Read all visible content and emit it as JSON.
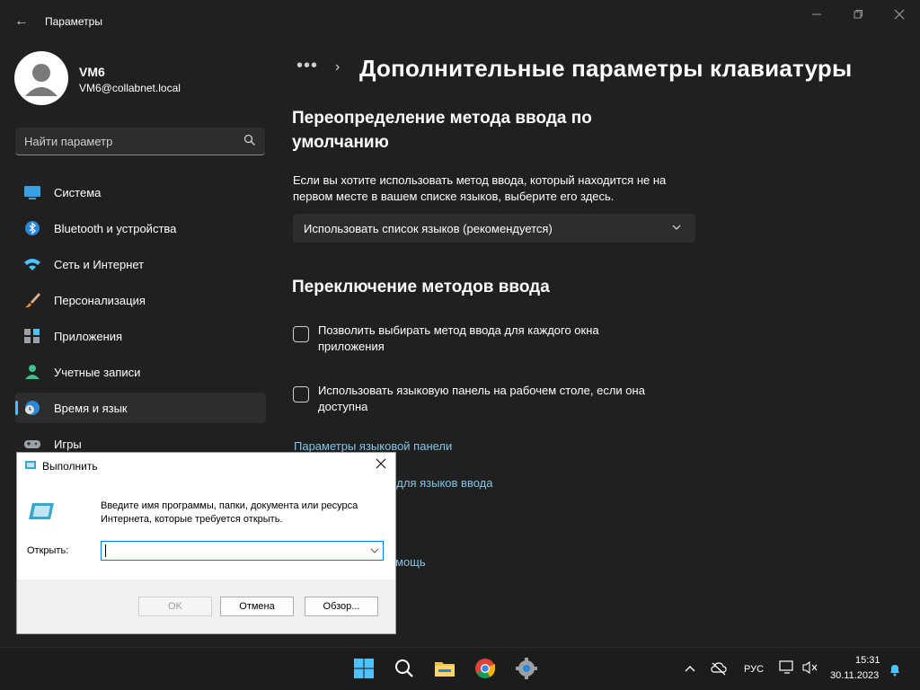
{
  "window": {
    "title": "Параметры",
    "controls": [
      "minimize-icon",
      "maximize-icon",
      "close-icon"
    ]
  },
  "profile": {
    "name": "VM6",
    "email": "VM6@collabnet.local"
  },
  "search": {
    "placeholder": "Найти параметр"
  },
  "sidebar": {
    "items": [
      {
        "label": "Система",
        "icon": "system-icon"
      },
      {
        "label": "Bluetooth и устройства",
        "icon": "bluetooth-icon"
      },
      {
        "label": "Сеть и Интернет",
        "icon": "wifi-icon"
      },
      {
        "label": "Персонализация",
        "icon": "brush-icon"
      },
      {
        "label": "Приложения",
        "icon": "apps-icon"
      },
      {
        "label": "Учетные записи",
        "icon": "accounts-icon"
      },
      {
        "label": "Время и язык",
        "icon": "time-language-icon",
        "active": true
      },
      {
        "label": "Игры",
        "icon": "gamepad-icon"
      }
    ]
  },
  "breadcrumb": {
    "dots": "•••",
    "chevron": "›",
    "title": "Дополнительные параметры клавиатуры"
  },
  "override_section": {
    "title_line1": "Переопределение метода ввода по",
    "title_line2": "умолчанию",
    "description_line1": "Если вы хотите использовать метод ввода, который находится не на",
    "description_line2": "первом месте в вашем списке языков, выберите его здесь.",
    "dropdown_value": "Использовать список языков (рекомендуется)"
  },
  "switching_section": {
    "title": "Переключение методов ввода",
    "checkbox1_line1": "Позволить выбирать метод ввода для каждого окна",
    "checkbox1_line2": "приложения",
    "checkbox1_checked": false,
    "checkbox2_line1": "Использовать языковую панель на рабочем столе, если она",
    "checkbox2_line2": "доступна",
    "checkbox2_checked": false,
    "link_language_bar": "Параметры языковой панели",
    "link_hotkeys_partial": "ши для языков ввода",
    "link_help_partial": "мощь"
  },
  "run_dialog": {
    "title": "Выполнить",
    "description_line1": "Введите имя программы, папки, документа или ресурса",
    "description_line2": "Интернета, которые требуется открыть.",
    "open_label": "Открыть:",
    "input_value": "",
    "ok_label": "OK",
    "cancel_label": "Отмена",
    "browse_label": "Обзор..."
  },
  "taskbar": {
    "apps": [
      "windows-start-icon",
      "search-icon",
      "file-explorer-icon",
      "chrome-icon",
      "settings-icon"
    ],
    "tray_language": "РУС",
    "time": "15:31",
    "date": "30.11.2023"
  },
  "colors": {
    "background": "#202020",
    "accent": "#4cc2ff",
    "link": "#84c5e6"
  }
}
